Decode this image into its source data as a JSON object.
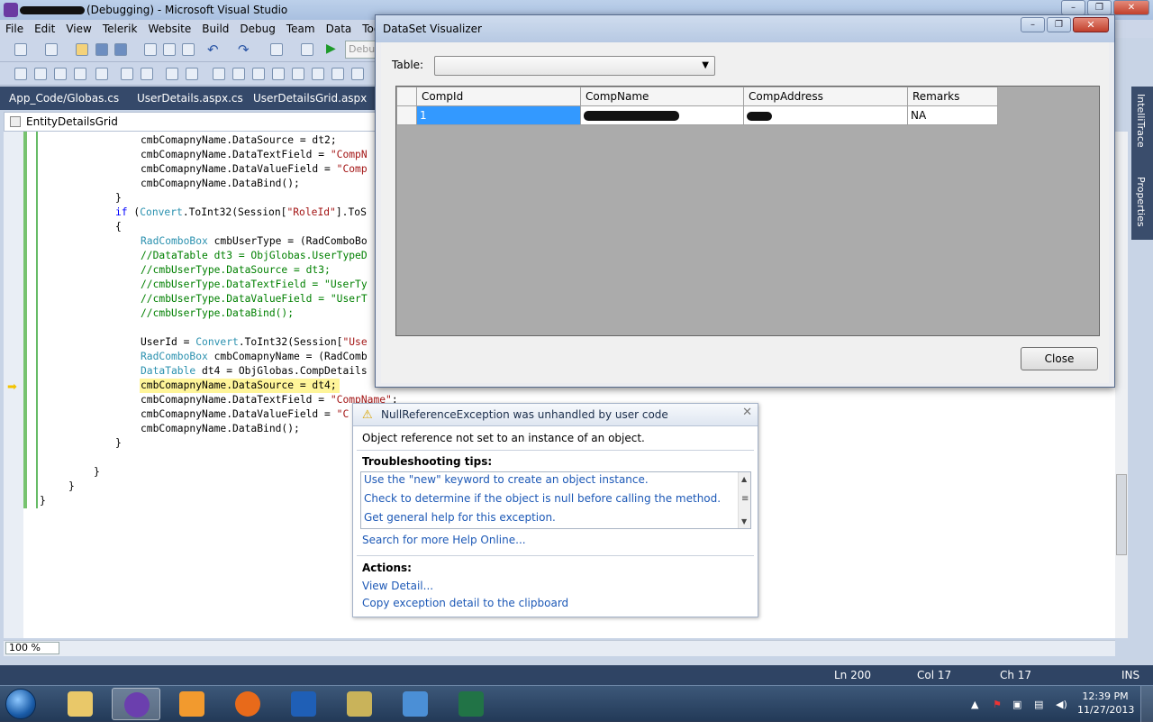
{
  "vs": {
    "title_suffix": "(Debugging) - Microsoft Visual Studio",
    "menu": [
      "File",
      "Edit",
      "View",
      "Telerik",
      "Website",
      "Build",
      "Debug",
      "Team",
      "Data",
      "Tools"
    ],
    "debug_combo": "Debu",
    "tabs": [
      "App_Code/Globas.cs",
      "UserDetails.aspx.cs",
      "UserDetailsGrid.aspx"
    ],
    "nav_class": "EntityDetailsGrid",
    "right_tabs": [
      "IntelliTrace",
      "Properties"
    ],
    "zoom": "100 %",
    "status": {
      "ln": "Ln 200",
      "col": "Col 17",
      "ch": "Ch 17",
      "mode": "INS"
    }
  },
  "code_lines": [
    {
      "t": "cmbComapnyName.DataSource = dt2;",
      "i": 152
    },
    {
      "t": "cmbComapnyName.DataTextField = \"CompN",
      "i": 152
    },
    {
      "t": "cmbComapnyName.DataValueField = \"Comp",
      "i": 152
    },
    {
      "t": "cmbComapnyName.DataBind();",
      "i": 152
    },
    {
      "t": "}",
      "i": 124
    },
    {
      "t": "if (Convert.ToInt32(Session[\"RoleId\"].ToS",
      "i": 124
    },
    {
      "t": "{",
      "i": 124
    },
    {
      "t": "RadComboBox cmbUserType = (RadComboBo",
      "i": 152
    },
    {
      "t": "//DataTable dt3 = ObjGlobas.UserTypeD",
      "i": 152
    },
    {
      "t": "//cmbUserType.DataSource = dt3;",
      "i": 152
    },
    {
      "t": "//cmbUserType.DataTextField = \"UserTy",
      "i": 152
    },
    {
      "t": "//cmbUserType.DataValueField = \"UserT",
      "i": 152
    },
    {
      "t": "//cmbUserType.DataBind();",
      "i": 152
    },
    {
      "t": "",
      "i": 152
    },
    {
      "t": "UserId = Convert.ToInt32(Session[\"Use",
      "i": 152
    },
    {
      "t": "RadComboBox cmbComapnyName = (RadComb",
      "i": 152
    },
    {
      "t": "DataTable dt4 = ObjGlobas.CompDetails",
      "i": 152
    },
    {
      "t": "cmbComapnyName.DataSource = dt4;",
      "i": 152
    },
    {
      "t": "cmbComapnyName.DataTextField = \"CompName\";",
      "i": 152
    },
    {
      "t": "cmbComapnyName.DataValueField = \"C",
      "i": 152
    },
    {
      "t": "cmbComapnyName.DataBind();",
      "i": 152
    },
    {
      "t": "}",
      "i": 124
    },
    {
      "t": "",
      "i": 124
    },
    {
      "t": "}",
      "i": 100
    },
    {
      "t": "}",
      "i": 72
    },
    {
      "t": "}",
      "i": 40
    }
  ],
  "visualizer": {
    "title": "DataSet Visualizer",
    "table_label": "Table:",
    "table_value": "",
    "columns": [
      "CompId",
      "CompName",
      "CompAddress",
      "Remarks"
    ],
    "rows": [
      {
        "CompId": "1",
        "CompName": "",
        "CompAddress": "",
        "Remarks": "NA"
      }
    ],
    "close_label": "Close"
  },
  "exception": {
    "title": "NullReferenceException was unhandled by user code",
    "message": "Object reference not set to an instance of an object.",
    "tips_heading": "Troubleshooting tips:",
    "tips": [
      "Use the \"new\" keyword to create an object instance.",
      "Check to determine if the object is null before calling the method.",
      "Get general help for this exception."
    ],
    "search_link": "Search for more Help Online...",
    "actions_heading": "Actions:",
    "actions": [
      "View Detail...",
      "Copy exception detail to the clipboard"
    ]
  },
  "taskbar": {
    "apps": [
      "windows-explorer",
      "visual-studio",
      "media-player",
      "firefox",
      "outlook",
      "tools",
      "virtualbox",
      "excel"
    ],
    "time": "12:39 PM",
    "date": "11/27/2013"
  },
  "colors": {
    "accent": "#3399ff",
    "warning": "#d9a400",
    "link": "#1c58b6"
  }
}
